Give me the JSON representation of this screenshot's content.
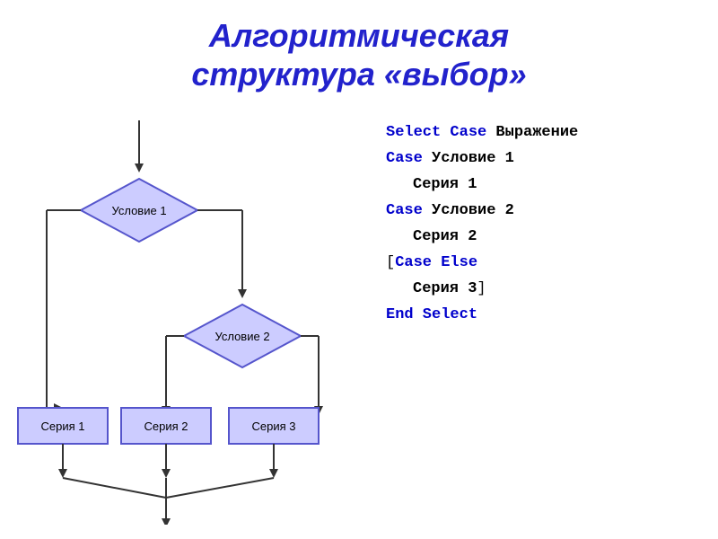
{
  "title": {
    "line1": "Алгоритмическая",
    "line2": "структура «выбор»"
  },
  "flowchart": {
    "diamond1_label": "Условие 1",
    "diamond2_label": "Условие 2",
    "box1_label": "Серия 1",
    "box2_label": "Серия 2",
    "box3_label": "Серия 3"
  },
  "code": {
    "line1_kw": "Select Case",
    "line1_rest": " Выражение",
    "line2_kw": "Case",
    "line2_rest": " Условие 1",
    "line3": "Серия 1",
    "line4_kw": "Case",
    "line4_rest": " Условие 2",
    "line5": "Серия 2",
    "line6_bracket": "[",
    "line6_kw": "Case Else",
    "line7": "Серия 3",
    "line7_bracket": "]",
    "line8_kw": "End Select"
  }
}
